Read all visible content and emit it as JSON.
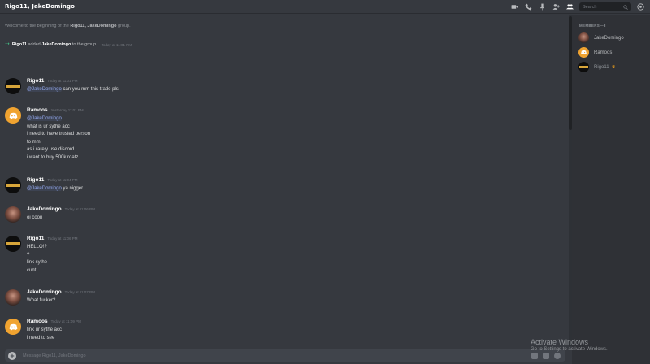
{
  "window": {
    "title": "Rigo11, JakeDomingo"
  },
  "toolbar": {
    "icons": [
      "video-icon",
      "phone-icon",
      "pin-icon",
      "add-member-icon",
      "members-icon",
      "help-icon"
    ],
    "search_placeholder": "Search"
  },
  "welcome": {
    "prefix": "Welcome to the beginning of the ",
    "group": "Rigo11, JakeDomingo",
    "suffix": " group."
  },
  "system_message": {
    "actor": "Rigo11",
    "verb": " added ",
    "target": "JakeDomingo",
    "tail": " to the group.",
    "timestamp": "Today at 11:01 PM"
  },
  "messages": [
    {
      "author": "Rigo11",
      "avatar": "rigo",
      "timestamp": "Today at 11:01 PM",
      "lines": [
        {
          "mention": "@JakeDomingo",
          "text": " can you mm this trade pls"
        }
      ]
    },
    {
      "author": "Ramoos",
      "avatar": "ramoos",
      "timestamp": "Yesterday 11:01 PM",
      "lines": [
        {
          "mention": "@JakeDomingo",
          "text": ""
        },
        {
          "text": "what is ur sythe acc"
        },
        {
          "text": "I need to have trusted person"
        },
        {
          "text": "to mm"
        },
        {
          "text": "as i rarely use discord"
        },
        {
          "text": "i want to buy 500k roatz"
        }
      ]
    },
    {
      "author": "Rigo11",
      "avatar": "rigo",
      "timestamp": "Today at 11:04 PM",
      "lines": [
        {
          "mention": "@JakeDomingo",
          "text": " ya nigger"
        }
      ]
    },
    {
      "author": "JakeDomingo",
      "avatar": "jake",
      "timestamp": "Today at 11:06 PM",
      "lines": [
        {
          "text": "oi coon"
        }
      ]
    },
    {
      "author": "Rigo11",
      "avatar": "rigo",
      "timestamp": "Today at 11:06 PM",
      "lines": [
        {
          "text": "HELLO!?"
        },
        {
          "text": "?"
        },
        {
          "text": "link sythe"
        },
        {
          "text": "cunt"
        }
      ]
    },
    {
      "author": "JakeDomingo",
      "avatar": "jake",
      "timestamp": "Today at 11:07 PM",
      "lines": [
        {
          "text": "What fucker?"
        }
      ]
    },
    {
      "author": "Ramoos",
      "avatar": "ramoos",
      "timestamp": "Today at 11:09 PM",
      "lines": [
        {
          "text": "link ur sythe acc"
        },
        {
          "text": "i need to see"
        }
      ]
    }
  ],
  "composer": {
    "placeholder": "Message Rigo11, JakeDomingo"
  },
  "members": {
    "header": "MEMBERS—3",
    "list": [
      {
        "name": "JakeDomingo",
        "avatar": "jake",
        "dim": false,
        "owner": false
      },
      {
        "name": "Ramoos",
        "avatar": "ramoos",
        "dim": false,
        "owner": false
      },
      {
        "name": "Rigo11",
        "avatar": "rigo",
        "dim": true,
        "owner": true
      }
    ]
  },
  "overlay": {
    "title": "Activate Windows",
    "subtitle": "Go to Settings to activate Windows."
  },
  "colors": {
    "background": "#36393f",
    "sidebar": "#2f3136",
    "mention": "#8ea1e1",
    "online": "#43b581",
    "ramoos_avatar": "#f0a330"
  }
}
